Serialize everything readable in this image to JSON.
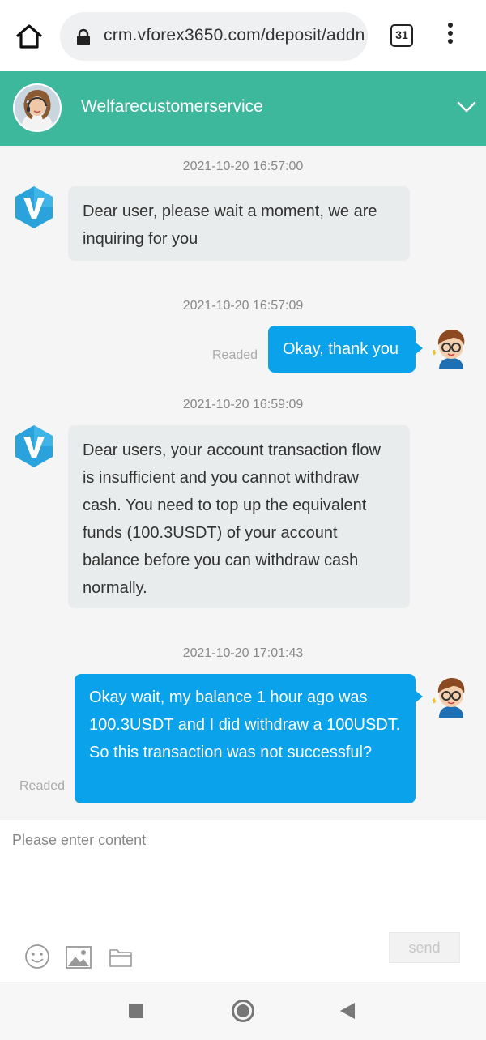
{
  "browser": {
    "url": "crm.vforex3650.com/deposit/addn",
    "tab_count": "31"
  },
  "header": {
    "agent_name": "Welfarecustomerservice"
  },
  "messages": [
    {
      "timestamp": "2021-10-20 16:57:00",
      "from": "agent",
      "text": "Dear user, please wait a moment, we are inquiring for you"
    },
    {
      "timestamp": "2021-10-20 16:57:09",
      "from": "user",
      "text": "Okay, thank you",
      "status": "Readed"
    },
    {
      "timestamp": "2021-10-20 16:59:09",
      "from": "agent",
      "text": "Dear users, your account transaction flow is insufficient and you cannot withdraw cash. You need to top up the equivalent funds (100.3USDT) of your account balance before you can withdraw cash normally."
    },
    {
      "timestamp": "2021-10-20 17:01:43",
      "from": "user",
      "text": "Okay wait, my balance 1 hour ago was 100.3USDT and I did withdraw a 100USDT. So this transaction was not successful?",
      "status": "Readed"
    }
  ],
  "composer": {
    "placeholder": "Please enter content",
    "send_label": "send"
  },
  "colors": {
    "header": "#3db89d",
    "user_bubble": "#0aa2ea",
    "agent_bubble": "#e9ecec"
  },
  "icons": {
    "browser": [
      "home-icon",
      "lock-icon",
      "tabs-icon",
      "more-vert-icon"
    ],
    "header": [
      "chevron-down-icon"
    ],
    "composer": [
      "emoji-icon",
      "image-icon",
      "folder-icon"
    ],
    "nav": [
      "recent-apps-icon",
      "home-circle-icon",
      "back-triangle-icon"
    ]
  }
}
